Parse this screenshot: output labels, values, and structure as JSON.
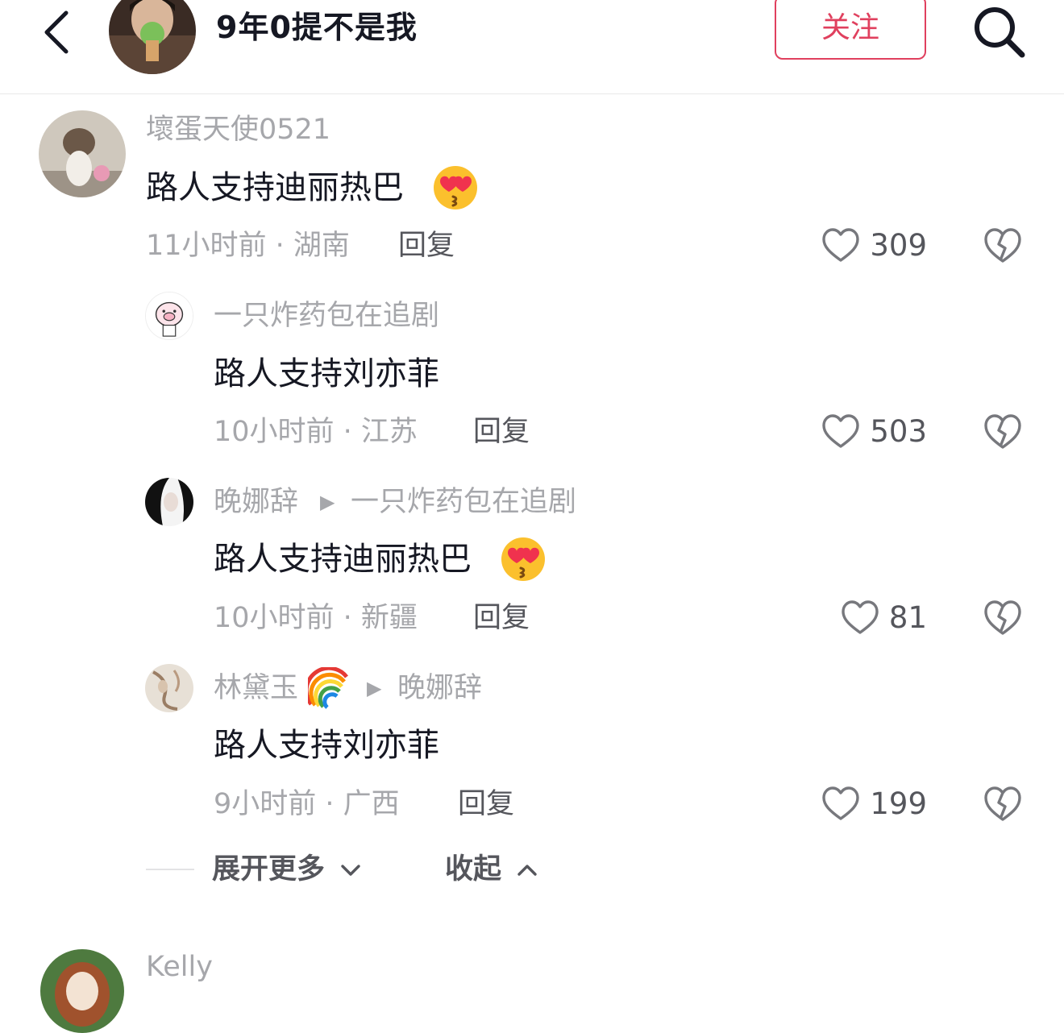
{
  "header": {
    "title": "9年0提不是我",
    "follow_label": "关注"
  },
  "comments": [
    {
      "username": "壞蛋天使0521",
      "text": "路人支持迪丽热巴",
      "emoji": "heart-eyes-kiss",
      "meta": "11小时前 · 湖南",
      "reply_label": "回复",
      "likes": "309"
    },
    {
      "username": "一只炸药包在追剧",
      "text": "路人支持刘亦菲",
      "meta": "10小时前 · 江苏",
      "reply_label": "回复",
      "likes": "503"
    },
    {
      "username": "晚娜辞",
      "reply_to": "一只炸药包在追剧",
      "text": "路人支持迪丽热巴",
      "emoji": "heart-eyes-kiss",
      "meta": "10小时前 · 新疆",
      "reply_label": "回复",
      "likes": "81"
    },
    {
      "username": "林黛玉",
      "username_emoji": "rainbow",
      "reply_to": "晚娜辞",
      "text": "路人支持刘亦菲",
      "meta": "9小时前 · 广西",
      "reply_label": "回复",
      "likes": "199"
    }
  ],
  "thread_controls": {
    "expand_label": "展开更多",
    "collapse_label": "收起"
  },
  "next_comment": {
    "username": "Kelly"
  },
  "colors": {
    "accent": "#e0405e",
    "text_primary": "#161823",
    "text_secondary": "#a6a7ab",
    "text_action": "#55565c"
  }
}
